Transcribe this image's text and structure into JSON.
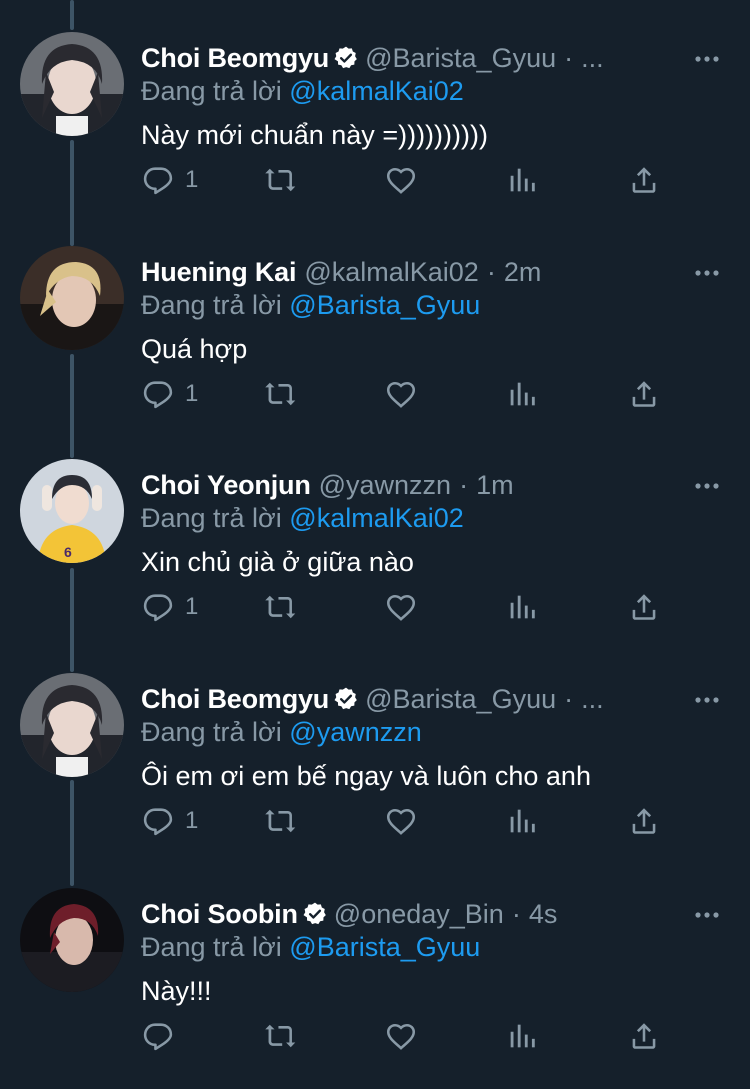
{
  "thread": {
    "tweets": [
      {
        "name": "Choi Beomgyu",
        "verified": true,
        "handle": "@Barista_Gyuu",
        "dot": "·",
        "time": "...",
        "reply_prefix": "Đang trả lời",
        "reply_to": "@kalmalKai02",
        "text": "Này mới chuẩn này =))))))))))",
        "reply_count": "1",
        "avatar_icon": "profile-photo"
      },
      {
        "name": "Huening Kai",
        "verified": false,
        "handle": "@kalmalKai02",
        "dot": "·",
        "time": "2m",
        "reply_prefix": "Đang trả lời",
        "reply_to": "@Barista_Gyuu",
        "text": "Quá hợp",
        "reply_count": "1",
        "avatar_icon": "profile-photo"
      },
      {
        "name": "Choi Yeonjun",
        "verified": false,
        "handle": "@yawnzzn",
        "dot": "·",
        "time": "1m",
        "reply_prefix": "Đang trả lời",
        "reply_to": "@kalmalKai02",
        "text": "Xin chủ già ở giữa nào",
        "reply_count": "1",
        "avatar_icon": "profile-photo"
      },
      {
        "name": "Choi Beomgyu",
        "verified": true,
        "handle": "@Barista_Gyuu",
        "dot": "·",
        "time": "...",
        "reply_prefix": "Đang trả lời",
        "reply_to": "@yawnzzn",
        "text": "Ôi em ơi em bế ngay và luôn cho anh",
        "reply_count": "1",
        "avatar_icon": "profile-photo"
      },
      {
        "name": "Choi Soobin",
        "verified": true,
        "handle": "@oneday_Bin",
        "dot": "·",
        "time": "4s",
        "reply_prefix": "Đang trả lời",
        "reply_to": "@Barista_Gyuu",
        "text": "Này!!!",
        "reply_count": "",
        "avatar_icon": "profile-photo"
      }
    ]
  },
  "colors": {
    "background": "#15202b",
    "muted": "#8899a6",
    "accent": "#1d9bf0",
    "thread_line": "#3d5466"
  },
  "icons": [
    "reply-icon",
    "retweet-icon",
    "like-icon",
    "analytics-icon",
    "share-icon",
    "more-icon",
    "verified-badge-icon"
  ]
}
